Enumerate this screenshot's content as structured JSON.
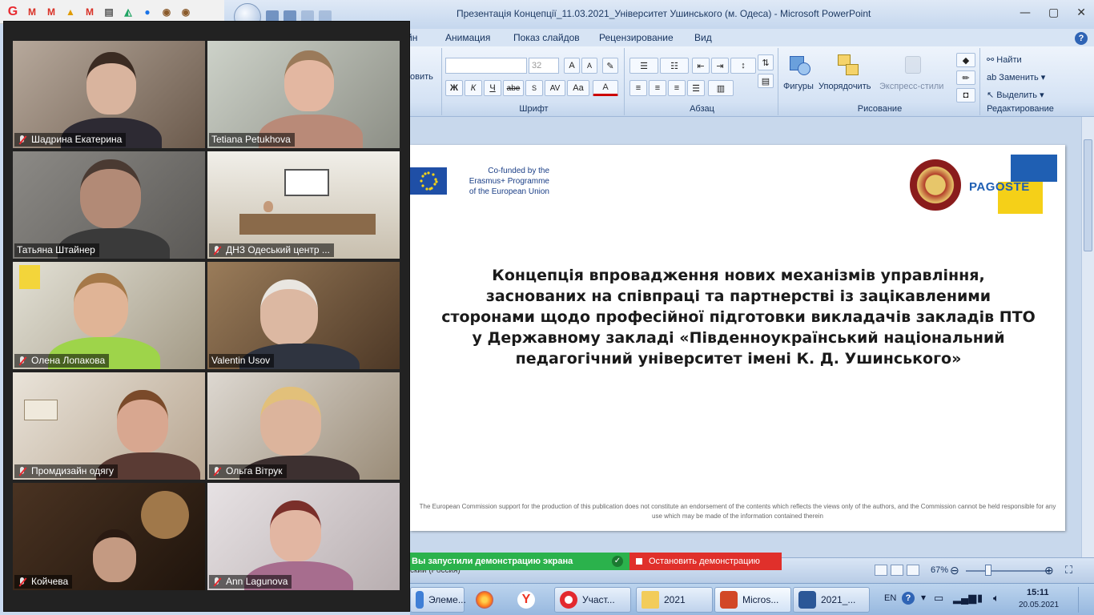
{
  "powerpoint": {
    "window_title": "Презентація Концепції_11.03.2021_Університет Ушинського (м. Одеса) - Microsoft PowerPoint",
    "tabs": [
      "йн",
      "Анимация",
      "Показ слайдов",
      "Рецензирование",
      "Вид"
    ],
    "ribbon": {
      "font_size": "32",
      "partial_button": "овить",
      "group_font": "Шрифт",
      "group_paragraph": "Абзац",
      "group_drawing": "Рисование",
      "group_editing": "Редактирование",
      "btn_shapes": "Фигуры",
      "btn_arrange": "Упорядочить",
      "btn_quick_styles": "Экспресс-стили",
      "btn_find": "Найти",
      "btn_replace": "Заменить",
      "btn_select": "Выделить",
      "fmt_bold": "Ж",
      "fmt_italic": "К",
      "fmt_underline": "Ч",
      "fmt_strike": "abe",
      "fmt_aa": "Аа",
      "fmt_color": "А"
    },
    "slide": {
      "eu_text": "Co-funded by the\nErasmus+ Programme\nof the European Union",
      "pagoste": "PAGOSTE",
      "title_lines": [
        "Концепція впровадження нових механізмів управління,",
        "заснованих на співпраці та партнерстві із зацікавленими",
        "сторонами щодо професійної підготовки викладачів закладів ПТО",
        "у Державному закладі «Південноукраїнський національний",
        "педагогічний університет імені К. Д. Ушинського»"
      ],
      "disclaimer": "The European Commission support for the production of this publication does not constitute an endorsement of the contents which reflects the views only of the authors, and the Commission cannot be held responsible for any use which may be made of the information contained therein"
    },
    "status": {
      "language": "ский (Россия)",
      "zoom": "67%"
    }
  },
  "screen_share": {
    "notice": "Вы запустили демонстрацию экрана",
    "stop_label": "Остановить демонстрацию"
  },
  "gallery": {
    "participants": [
      {
        "name": "Шадрина Екатерина",
        "muted": true
      },
      {
        "name": "Tetiana Petukhova",
        "muted": false
      },
      {
        "name": "Татьяна Штайнер",
        "muted": false
      },
      {
        "name": "ДНЗ Одеський центр ...",
        "muted": true
      },
      {
        "name": "Олена Лопакова",
        "muted": true
      },
      {
        "name": "Valentin Usov",
        "muted": false
      },
      {
        "name": "Промдизайн одягу",
        "muted": true
      },
      {
        "name": "Ольга Вітрук",
        "muted": true
      },
      {
        "name": "Койчева",
        "muted": true
      },
      {
        "name": "Ann Lagunova",
        "muted": true
      }
    ]
  },
  "taskbar": {
    "items": [
      "Элеме...",
      "Участ...",
      "2021",
      "Micros...",
      "2021_..."
    ],
    "lang": "EN",
    "time": "15:11",
    "date": "20.05.2021"
  },
  "colors": {
    "share_green": "#2bb24c",
    "stop_red": "#e0302b",
    "ribbon_blue": "#d4e2f4"
  }
}
